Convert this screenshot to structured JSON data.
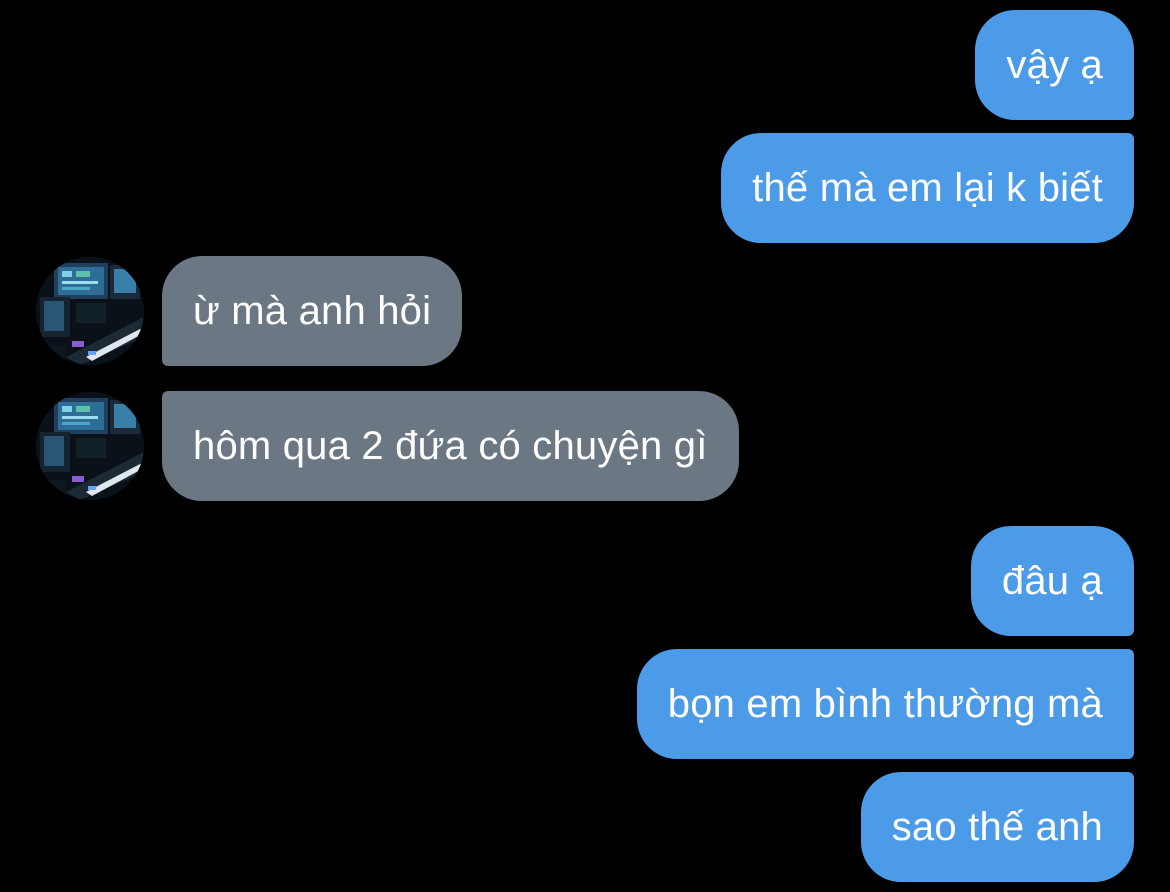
{
  "conversation": {
    "messages": [
      {
        "direction": "outgoing",
        "text": "vậy ạ"
      },
      {
        "direction": "outgoing",
        "text": "thế mà em lại k biết"
      },
      {
        "direction": "incoming",
        "text": "ừ mà anh hỏi"
      },
      {
        "direction": "incoming",
        "text": "hôm qua 2 đứa có chuyện gì"
      },
      {
        "direction": "outgoing",
        "text": "đâu ạ"
      },
      {
        "direction": "outgoing",
        "text": "bọn em bình thường mà"
      },
      {
        "direction": "outgoing",
        "text": "sao thế anh"
      }
    ]
  },
  "contact": {
    "avatar_icon": "music-studio-avatar"
  },
  "colors": {
    "background": "#000000",
    "outgoing_bubble": "#4c9be8",
    "incoming_bubble": "#6b7783",
    "text": "#ffffff"
  }
}
